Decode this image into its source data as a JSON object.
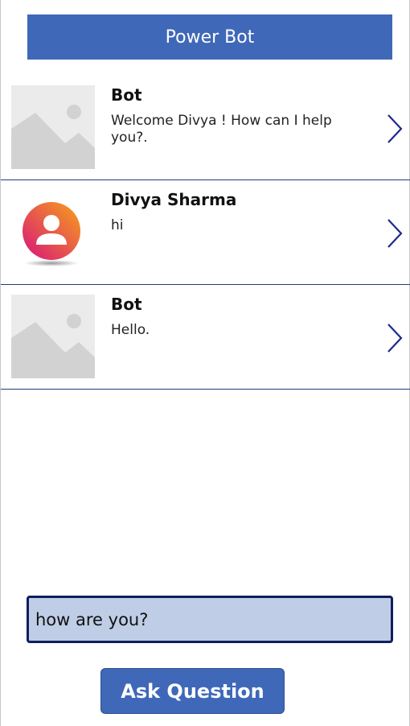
{
  "app": {
    "title": "Power Bot"
  },
  "messages": [
    {
      "sender": "Bot",
      "text": "Welcome Divya ! How can I help you?.",
      "image": "placeholder-image-icon"
    },
    {
      "sender": "Divya Sharma",
      "text": "hi",
      "image": "user-avatar-icon"
    },
    {
      "sender": "Bot",
      "text": "Hello.",
      "image": "placeholder-image-icon"
    }
  ],
  "input": {
    "value": "how are you?",
    "placeholder": ""
  },
  "ask_button": {
    "label": "Ask Question"
  },
  "colors": {
    "accent": "#3f68b8",
    "input_bg": "#bfcde6",
    "input_border": "#0f1f5c",
    "divider": "#1f3f7a"
  }
}
